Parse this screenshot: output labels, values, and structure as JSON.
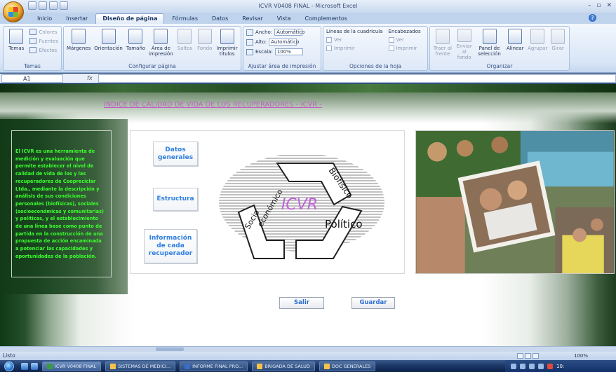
{
  "window": {
    "title": "ICVR V0408 FINAL - Microsoft Excel",
    "controls": [
      "–",
      "▫",
      "✕"
    ]
  },
  "ribbon": {
    "tabs": [
      "Inicio",
      "Insertar",
      "Diseño de página",
      "Fórmulas",
      "Datos",
      "Revisar",
      "Vista",
      "Complementos"
    ],
    "active_tab": "Diseño de página",
    "groups": {
      "temas": {
        "label": "Temas",
        "big": "Temas",
        "small": [
          "Colores",
          "Fuentes",
          "Efectos"
        ]
      },
      "configurar": {
        "label": "Configurar página",
        "buttons": [
          "Márgenes",
          "Orientación",
          "Tamaño",
          "Área de impresión",
          "Saltos",
          "Fondo",
          "Imprimir títulos"
        ]
      },
      "ajustar": {
        "label": "Ajustar área de impresión",
        "rows": [
          {
            "label": "Ancho:",
            "value": "Automático"
          },
          {
            "label": "Alto:",
            "value": "Automático"
          },
          {
            "label": "Escala:",
            "value": "100%"
          }
        ]
      },
      "opciones": {
        "label": "Opciones de la hoja",
        "col1_title": "Líneas de la cuadrícula",
        "col2_title": "Encabezados",
        "ver": "Ver",
        "imprimir": "Imprimir"
      },
      "organizar": {
        "label": "Organizar",
        "buttons": [
          "Traer al frente",
          "Enviar al fondo",
          "Panel de selección",
          "Alinear",
          "Agrupar",
          "Girar"
        ]
      }
    }
  },
  "formula_bar": {
    "name_box": "A1",
    "fx": "fx",
    "value": ""
  },
  "sheet": {
    "heading": "INDICE DE CALIDAD DE VIDA DE LOS RECUPERADORES - ICVR -",
    "description": "El ICVR es una herramienta de medición y evaluación que permite establecer el nivel de calidad de vida de los y las recuperadores de Coopreciclar Ltda., mediante la descripción y análisis de sus condiciones personales (biofísicas), sociales (socioeconómicas y comunitarias) y políticas, y el establecimiento de una línea base como punto de partida en la construcción de una propuesta de acción encaminada a potenciar las capacidades y oportunidades de la población.",
    "nav_buttons": {
      "datos": "Datos generales",
      "estructura": "Estructura",
      "info": "Información de cada recuperador"
    },
    "diagram": {
      "center": "ICVR",
      "labels": [
        "Biofísico",
        "Socio económico",
        "Político"
      ]
    },
    "actions": {
      "salir": "Salir",
      "guardar": "Guardar"
    }
  },
  "status": {
    "text": "Listo",
    "zoom": "100%"
  },
  "taskbar": {
    "items": [
      {
        "label": "ICVR V0408 FINAL",
        "kind": "xl"
      },
      {
        "label": "SISTEMAS DE MEDICI...",
        "kind": "folder"
      },
      {
        "label": "INFORME FINAL PRO...",
        "kind": "wd"
      },
      {
        "label": "BRIGADA DE SALUD",
        "kind": "folder"
      },
      {
        "label": "DOC GENERALES",
        "kind": "folder"
      }
    ],
    "clock": "10:"
  }
}
